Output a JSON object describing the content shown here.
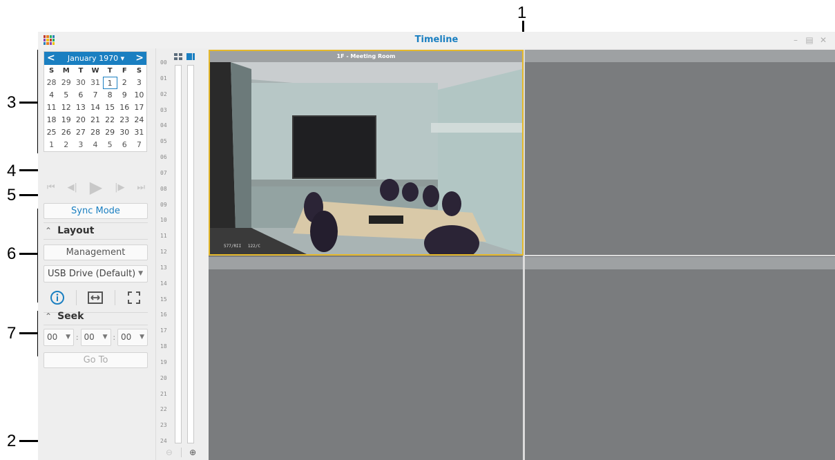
{
  "window": {
    "title": "Timeline"
  },
  "calendar": {
    "month_label": "January 1970 ▾",
    "prev": "<",
    "next": ">",
    "weekdays": [
      "S",
      "M",
      "T",
      "W",
      "T",
      "F",
      "S"
    ],
    "weeks": [
      [
        "28",
        "29",
        "30",
        "31",
        "1",
        "2",
        "3"
      ],
      [
        "4",
        "5",
        "6",
        "7",
        "8",
        "9",
        "10"
      ],
      [
        "11",
        "12",
        "13",
        "14",
        "15",
        "16",
        "17"
      ],
      [
        "18",
        "19",
        "20",
        "21",
        "22",
        "23",
        "24"
      ],
      [
        "25",
        "26",
        "27",
        "28",
        "29",
        "30",
        "31"
      ],
      [
        "1",
        "2",
        "3",
        "4",
        "5",
        "6",
        "7"
      ]
    ],
    "selected_day": "1"
  },
  "playback": {
    "icons": [
      "skip-to-start-icon",
      "previous-frame-icon",
      "play-icon",
      "next-frame-icon",
      "skip-to-end-icon"
    ]
  },
  "sync_mode": {
    "label": "Sync Mode"
  },
  "layout": {
    "heading": "Layout",
    "management_label": "Management",
    "storage_value": "USB Drive (Default)",
    "tools": [
      "info-icon",
      "fit-width-icon",
      "fullscreen-icon"
    ]
  },
  "seek": {
    "heading": "Seek",
    "hour": "00",
    "minute": "00",
    "second": "00",
    "separator": ":",
    "goto_label": "Go To"
  },
  "timeline": {
    "hours": [
      "00",
      "01",
      "02",
      "03",
      "04",
      "05",
      "06",
      "07",
      "08",
      "09",
      "10",
      "11",
      "12",
      "13",
      "14",
      "15",
      "16",
      "17",
      "18",
      "19",
      "20",
      "21",
      "22",
      "23",
      "24"
    ]
  },
  "camera": {
    "name": "1F - Meeting Room",
    "osd_left": "577/RII",
    "osd_right": "122/C"
  },
  "callouts": [
    "1",
    "2",
    "3",
    "4",
    "5",
    "6",
    "7"
  ],
  "colors": {
    "accent": "#1a7fc1",
    "selected_border": "#e5b82a",
    "grid_bg": "#7a7c7e"
  }
}
